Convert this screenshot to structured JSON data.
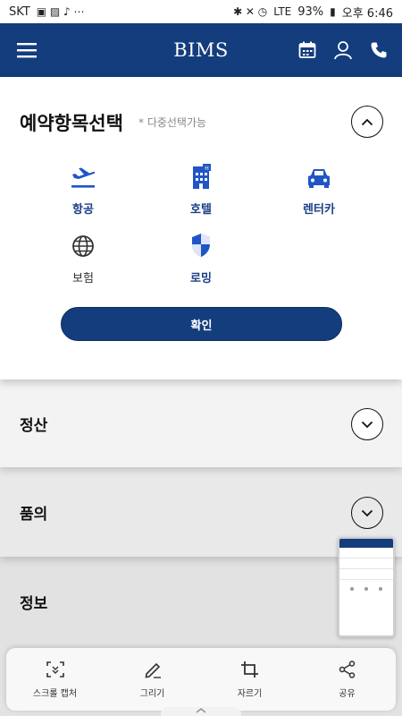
{
  "status_bar": {
    "carrier": "SKT",
    "battery_percent": "93%",
    "time": "오후 6:46",
    "network": "LTE"
  },
  "header": {
    "logo": "BIMS",
    "icons": [
      "menu-icon",
      "calendar-icon",
      "user-icon",
      "phone-icon"
    ]
  },
  "reservation": {
    "title": "예약항목선택",
    "subtitle": "* 다중선택가능",
    "items": [
      {
        "label": "항공",
        "icon": "airplane-icon"
      },
      {
        "label": "호텔",
        "icon": "hotel-icon"
      },
      {
        "label": "렌터카",
        "icon": "car-icon"
      },
      {
        "label": "보험",
        "icon": "globe-icon"
      },
      {
        "label": "로밍",
        "icon": "shield-icon"
      }
    ],
    "confirm_label": "확인"
  },
  "sections": [
    {
      "title": "정산"
    },
    {
      "title": "품의"
    },
    {
      "title": "정보"
    }
  ],
  "toolbar": {
    "items": [
      {
        "label": "스크롤 캡처",
        "icon": "scroll-capture-icon"
      },
      {
        "label": "그리기",
        "icon": "pen-icon"
      },
      {
        "label": "자르기",
        "icon": "crop-icon"
      },
      {
        "label": "공유",
        "icon": "share-icon"
      }
    ]
  },
  "colors": {
    "brand": "#133d7d",
    "icon_blue": "#1f55c6",
    "label_blue": "#1a3f86"
  }
}
